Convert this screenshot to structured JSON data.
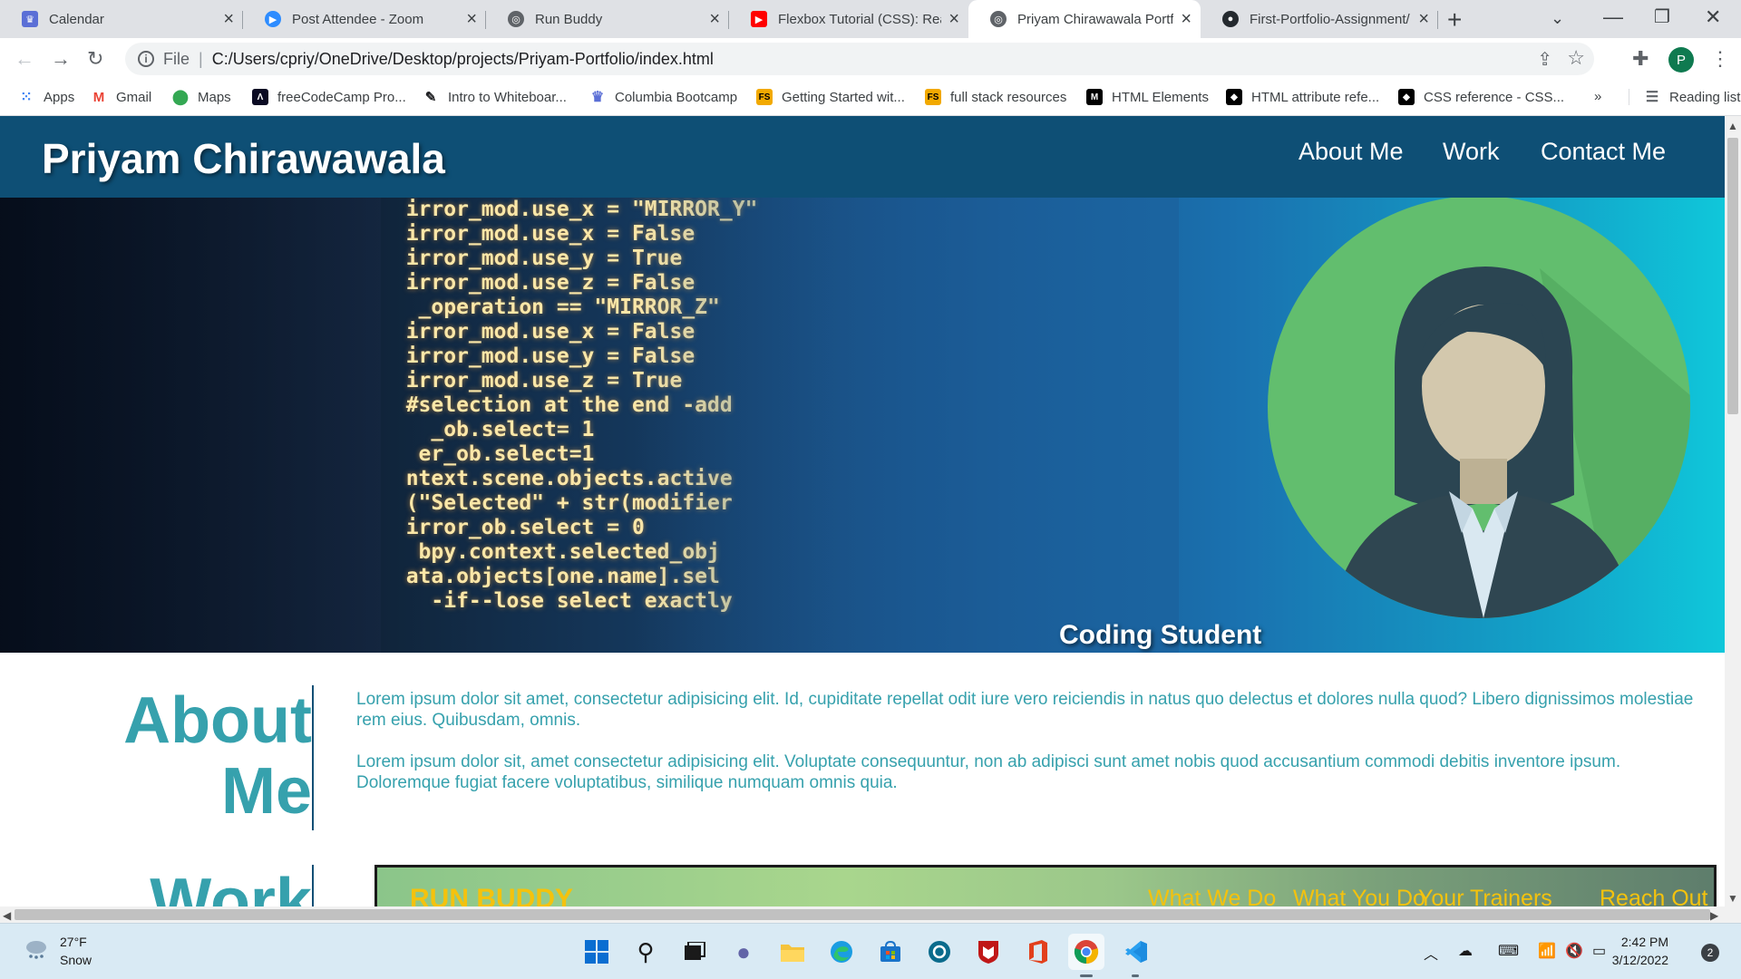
{
  "browser": {
    "tabs": [
      {
        "title": "Calendar",
        "active": false
      },
      {
        "title": "Post Attendee - Zoom",
        "active": false
      },
      {
        "title": "Run Buddy",
        "active": false
      },
      {
        "title": "Flexbox Tutorial (CSS): Real",
        "active": false
      },
      {
        "title": "Priyam Chirawawala Portfol",
        "active": true
      },
      {
        "title": "First-Portfolio-Assignment/",
        "active": false
      }
    ],
    "url": {
      "scheme": "File",
      "path": "C:/Users/cpriy/OneDrive/Desktop/projects/Priyam-Portfolio/index.html"
    },
    "profile_initial": "P",
    "bookmarks": [
      {
        "label": "Apps",
        "icon": "apps-grid-icon"
      },
      {
        "label": "Gmail",
        "icon": "gmail-icon"
      },
      {
        "label": "Maps",
        "icon": "maps-pin-icon"
      },
      {
        "label": "freeCodeCamp Pro...",
        "icon": "freecodecamp-icon"
      },
      {
        "label": "Intro to Whiteboar...",
        "icon": "pen-icon"
      },
      {
        "label": "Columbia Bootcamp",
        "icon": "columbia-crown-icon"
      },
      {
        "label": "Getting Started wit...",
        "icon": "fs-icon"
      },
      {
        "label": "full stack resources",
        "icon": "fs-icon"
      },
      {
        "label": "HTML Elements",
        "icon": "mdn-icon"
      },
      {
        "label": "HTML attribute refe...",
        "icon": "w3-icon"
      },
      {
        "label": "CSS reference - CSS...",
        "icon": "w3-icon"
      }
    ],
    "bookmarks_overflow": "»",
    "reading_list": "Reading list"
  },
  "page": {
    "site_name": "Priyam Chirawawala",
    "nav": [
      "About Me",
      "Work",
      "Contact Me"
    ],
    "hero": {
      "caption": "Coding Student",
      "code_lines": [
        "  irror_mod.use_x = \"MIRROR_Y\"",
        "  irror_mod.use_x = False",
        "  irror_mod.use_y = True",
        "  irror_mod.use_z = False",
        "   _operation == \"MIRROR_Z\"",
        "  irror_mod.use_x = False",
        "  irror_mod.use_y = False",
        "  irror_mod.use_z = True",
        "",
        "  #selection at the end -add",
        "    _ob.select= 1",
        "   er_ob.select=1",
        "  ntext.scene.objects.active",
        "  (\"Selected\" + str(modifier",
        "  irror_ob.select = 0",
        "   bpy.context.selected_obj",
        "  ata.objects[one.name].sel",
        "",
        "    -if--lose select exactly"
      ]
    },
    "about": {
      "heading_line1": "About",
      "heading_line2": "Me",
      "paragraph1": "Lorem ipsum dolor sit amet, consectetur adipisicing elit. Id, cupiditate repellat odit iure vero reiciendis in natus quo delectus et dolores nulla quod? Libero dignissimos molestiae rem eius. Quibusdam, omnis.",
      "paragraph2": "Lorem ipsum dolor sit, amet consectetur adipisicing elit. Voluptate consequuntur, non ab adipisci sunt amet nobis quod accusantium commodi debitis inventore ipsum. Doloremque fugiat facere voluptatibus, similique numquam omnis quia."
    },
    "work": {
      "heading": "Work",
      "card_title": "RUN BUDDY",
      "card_nav": [
        "What We Do",
        "What You Do",
        "Your Trainers",
        "Reach Out"
      ]
    }
  },
  "taskbar": {
    "weather": {
      "temp": "27°F",
      "desc": "Snow"
    },
    "apps": [
      "windows-start-icon",
      "search-icon",
      "task-view-icon",
      "teams-chat-icon",
      "file-explorer-icon",
      "edge-icon",
      "store-icon",
      "dell-icon",
      "mcafee-icon",
      "office-icon",
      "chrome-icon",
      "vscode-icon"
    ],
    "clock": {
      "time": "2:42 PM",
      "date": "3/12/2022"
    },
    "notification_count": "2"
  },
  "colors": {
    "header_bg": "#0e4f75",
    "accent_teal": "#36a1ad",
    "runbuddy_yellow": "#f4c20d",
    "avatar_green": "#62be6e"
  }
}
